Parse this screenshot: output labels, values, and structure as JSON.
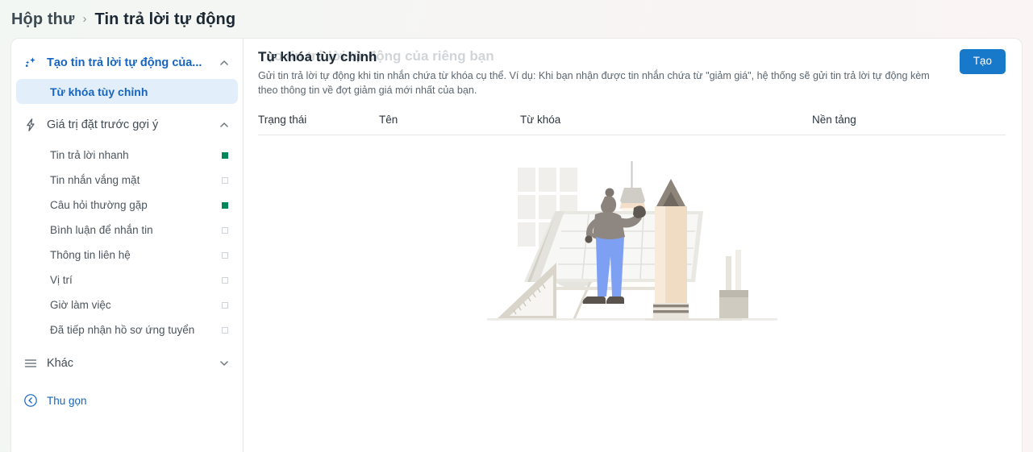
{
  "breadcrumb": {
    "root": "Hộp thư",
    "separator": "›",
    "current": "Tin trả lời tự động"
  },
  "sidebar": {
    "groups": [
      {
        "icon": "sparkle-icon",
        "label": "Tạo tin trả lời tự động của...",
        "expanded": true,
        "chevron": "chevron-up-icon",
        "items": [
          {
            "label": "Từ khóa tùy chỉnh",
            "selected": true,
            "status": "none"
          }
        ]
      },
      {
        "icon": "lightning-icon",
        "label": "Giá trị đặt trước gợi ý",
        "expanded": true,
        "chevron": "chevron-up-icon",
        "items": [
          {
            "label": "Tin trả lời nhanh",
            "selected": false,
            "status": "on"
          },
          {
            "label": "Tin nhắn vắng mặt",
            "selected": false,
            "status": "off"
          },
          {
            "label": "Câu hỏi thường gặp",
            "selected": false,
            "status": "on"
          },
          {
            "label": "Bình luận để nhắn tin",
            "selected": false,
            "status": "off"
          },
          {
            "label": "Thông tin liên hệ",
            "selected": false,
            "status": "off"
          },
          {
            "label": "Vị trí",
            "selected": false,
            "status": "off"
          },
          {
            "label": "Giờ làm việc",
            "selected": false,
            "status": "off"
          },
          {
            "label": "Đã tiếp nhận hồ sơ ứng tuyển",
            "selected": false,
            "status": "off"
          }
        ]
      },
      {
        "icon": "hamburger-icon",
        "label": "Khác",
        "expanded": false,
        "chevron": "chevron-down-icon",
        "items": []
      }
    ],
    "collapse": {
      "icon": "circle-chevron-left-icon",
      "label": "Thu gọn"
    }
  },
  "main": {
    "ghost_title": "Tạo tin trả lời tự động của riêng bạn",
    "title": "Từ khóa tùy chỉnh",
    "description": "Gửi tin trả lời tự động khi tin nhắn chứa từ khóa cụ thể. Ví dụ: Khi bạn nhận được tin nhắn chứa từ \"giảm giá\", hệ thống sẽ gửi tin trả lời tự động kèm theo thông tin về đợt giảm giá mới nhất của bạn.",
    "create_button": "Tạo",
    "table": {
      "columns": [
        "Trạng thái",
        "Tên",
        "Từ khóa",
        "Nền tảng"
      ],
      "rows": []
    },
    "empty_illustration": "drafting-desk-illustration"
  },
  "colors": {
    "accent_blue": "#1878c9",
    "link_blue": "#1565c0",
    "selected_bg": "#e2effb",
    "status_on": "#00875a",
    "status_off": "#ced4da",
    "text_dark": "#1b2733",
    "text_muted": "#5b6670"
  }
}
